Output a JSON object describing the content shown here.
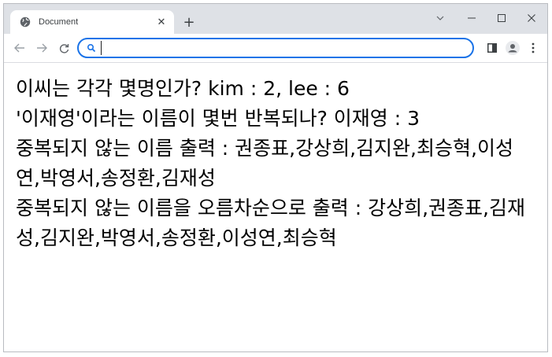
{
  "tab": {
    "title": "Document",
    "close_label": "✕"
  },
  "newtab_label": "+",
  "omnibox": {
    "value": "",
    "placeholder": ""
  },
  "content": {
    "lines": [
      "이씨는 각각 몇명인가? kim : 2, lee : 6",
      "'이재영'이라는 이름이 몇번 반복되나? 이재영 : 3",
      "중복되지 않는 이름 출력 : 권종표,강상희,김지완,최승혁,이성연,박영서,송정환,김재성",
      "중복되지 않는 이름을 오름차순으로 출력 : 강상희,권종표,김재성,김지완,박영서,송정환,이성연,최승혁"
    ]
  },
  "colors": {
    "accent": "#1a73e8",
    "tabstrip": "#dee1e6"
  }
}
